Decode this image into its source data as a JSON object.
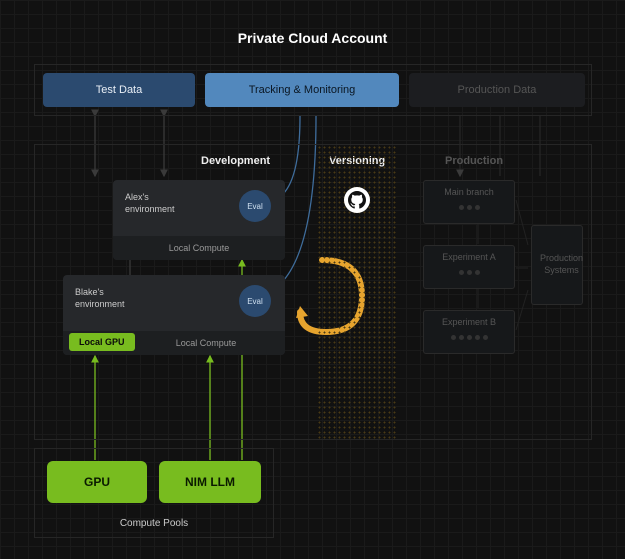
{
  "title": "Private Cloud Account",
  "top": {
    "test_data": "Test Data",
    "tracking": "Tracking & Monitoring",
    "prod_data": "Production Data"
  },
  "sections": {
    "development": "Development",
    "versioning": "Versioning",
    "production": "Production"
  },
  "dev": {
    "alex": {
      "name": "Alex's\nenvironment",
      "eval": "Eval",
      "local_compute": "Local Compute"
    },
    "blake": {
      "name": "Blake's\nenvironment",
      "eval": "Eval",
      "local_gpu": "Local GPU",
      "local_compute": "Local Compute"
    }
  },
  "prod": {
    "main_branch": "Main branch",
    "experiment_a": "Experiment A",
    "experiment_b": "Experiment B",
    "systems": "Production\nSystems"
  },
  "pools": {
    "gpu": "GPU",
    "nim": "NIM LLM",
    "label": "Compute Pools"
  },
  "colors": {
    "accent_green": "#78bc1f",
    "accent_blue": "#5288bd",
    "dark_blue": "#2b4a6f",
    "loop_orange": "#e6a42e"
  }
}
